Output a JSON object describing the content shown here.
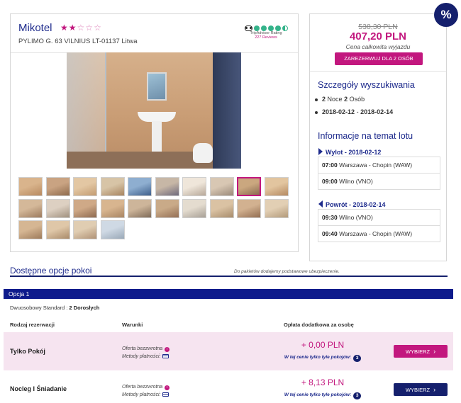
{
  "hotel": {
    "name": "Mikotel",
    "stars_filled": 2,
    "stars_total": 5,
    "address": "PYLIMO G. 63 VILNIUS LT-01137 Litwa",
    "tripadvisor": {
      "label": "TripAdvisor Rating",
      "reviews": "227 Reviews",
      "rating": 4.5
    }
  },
  "gallery": {
    "thumbnail_count": 24,
    "selected_index": 8
  },
  "price": {
    "old": "538,30 PLN",
    "new": "407,20 PLN",
    "caption": "Cena całkowita wyjazdu",
    "book_label": "ZAREZERWUJ DLA 2 OSÓB",
    "discount_badge": "%"
  },
  "search_details": {
    "title": "Szczegóły wyszukiwania",
    "nights": "2",
    "nights_label": "Noce",
    "persons": "2",
    "persons_label": "Osób",
    "date_from": "2018-02-12",
    "date_sep": "-",
    "date_to": "2018-02-14"
  },
  "flight_info": {
    "title": "Informacje na temat lotu",
    "outbound": {
      "label": "Wylot",
      "date": "2018-02-12",
      "legs": [
        {
          "time": "07:00",
          "place": "Warszawa - Chopin (WAW)"
        },
        {
          "time": "09:00",
          "place": "Wilno (VNO)"
        }
      ]
    },
    "return": {
      "label": "Powrót",
      "date": "2018-02-14",
      "legs": [
        {
          "time": "09:30",
          "place": "Wilno (VNO)"
        },
        {
          "time": "09:40",
          "place": "Warszawa - Chopin (WAW)"
        }
      ]
    }
  },
  "room_options": {
    "title": "Dostępne opcje pokoi",
    "note": "Do pakietów dodajemy podstawowe ubezpieczenie.",
    "option_label": "Opcja 1",
    "room_type": "Dwuosobowy Standard",
    "room_occupancy": "2 Dorosłych",
    "columns": {
      "type": "Rodzaj rezerwacji",
      "conditions": "Warunki",
      "fee": "Opłata dodatkowa za osobę"
    },
    "rows": [
      {
        "name": "Tylko Pokój",
        "offer": "Oferta bezzwrotna",
        "payment": "Metody płatności:",
        "fee": "+ 0,00 PLN",
        "fee_note": "W tej cenie tylko tyle pokojów:",
        "rooms_left": "3",
        "button": "WYBIERZ"
      },
      {
        "name": "Nocleg I Śniadanie",
        "offer": "Oferta bezzwrotna",
        "payment": "Metody płatności:",
        "fee": "+ 8,13 PLN",
        "fee_note": "W tej cenie tylko tyle pokojów:",
        "rooms_left": "3",
        "button": "WYBIERZ"
      }
    ]
  },
  "colors": {
    "brand_navy": "#15206d",
    "accent_pink": "#c2177e",
    "row_highlight": "#f6e4f0"
  }
}
